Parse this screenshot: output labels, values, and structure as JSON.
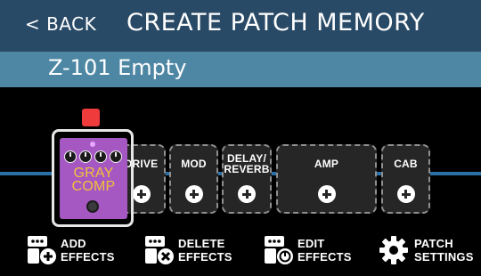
{
  "header": {
    "back_label": "< BACK",
    "title": "CREATE PATCH MEMORY"
  },
  "patch": {
    "name": "Z-101 Empty"
  },
  "chain": {
    "selected_effect": {
      "name_line1": "GRAY",
      "name_line2": "COMP",
      "color": "#a557c2"
    },
    "slots": [
      {
        "label_line1": "DRIVE",
        "label_line2": ""
      },
      {
        "label_line1": "MOD",
        "label_line2": ""
      },
      {
        "label_line1": "DELAY/",
        "label_line2": "REVERB"
      },
      {
        "label_line1": "AMP",
        "label_line2": ""
      },
      {
        "label_line1": "CAB",
        "label_line2": ""
      }
    ]
  },
  "footer": {
    "add": {
      "line1": "ADD",
      "line2": "EFFECTS"
    },
    "delete": {
      "line1": "DELETE",
      "line2": "EFFECTS"
    },
    "edit": {
      "line1": "EDIT",
      "line2": "EFFECTS"
    },
    "settings": {
      "line1": "PATCH",
      "line2": "SETTINGS"
    }
  },
  "colors": {
    "header_bg": "#294a66",
    "patch_bar_bg": "#4e87a4",
    "selection_indicator": "#ef3b3b",
    "signal_line": "#2a6fa6"
  }
}
